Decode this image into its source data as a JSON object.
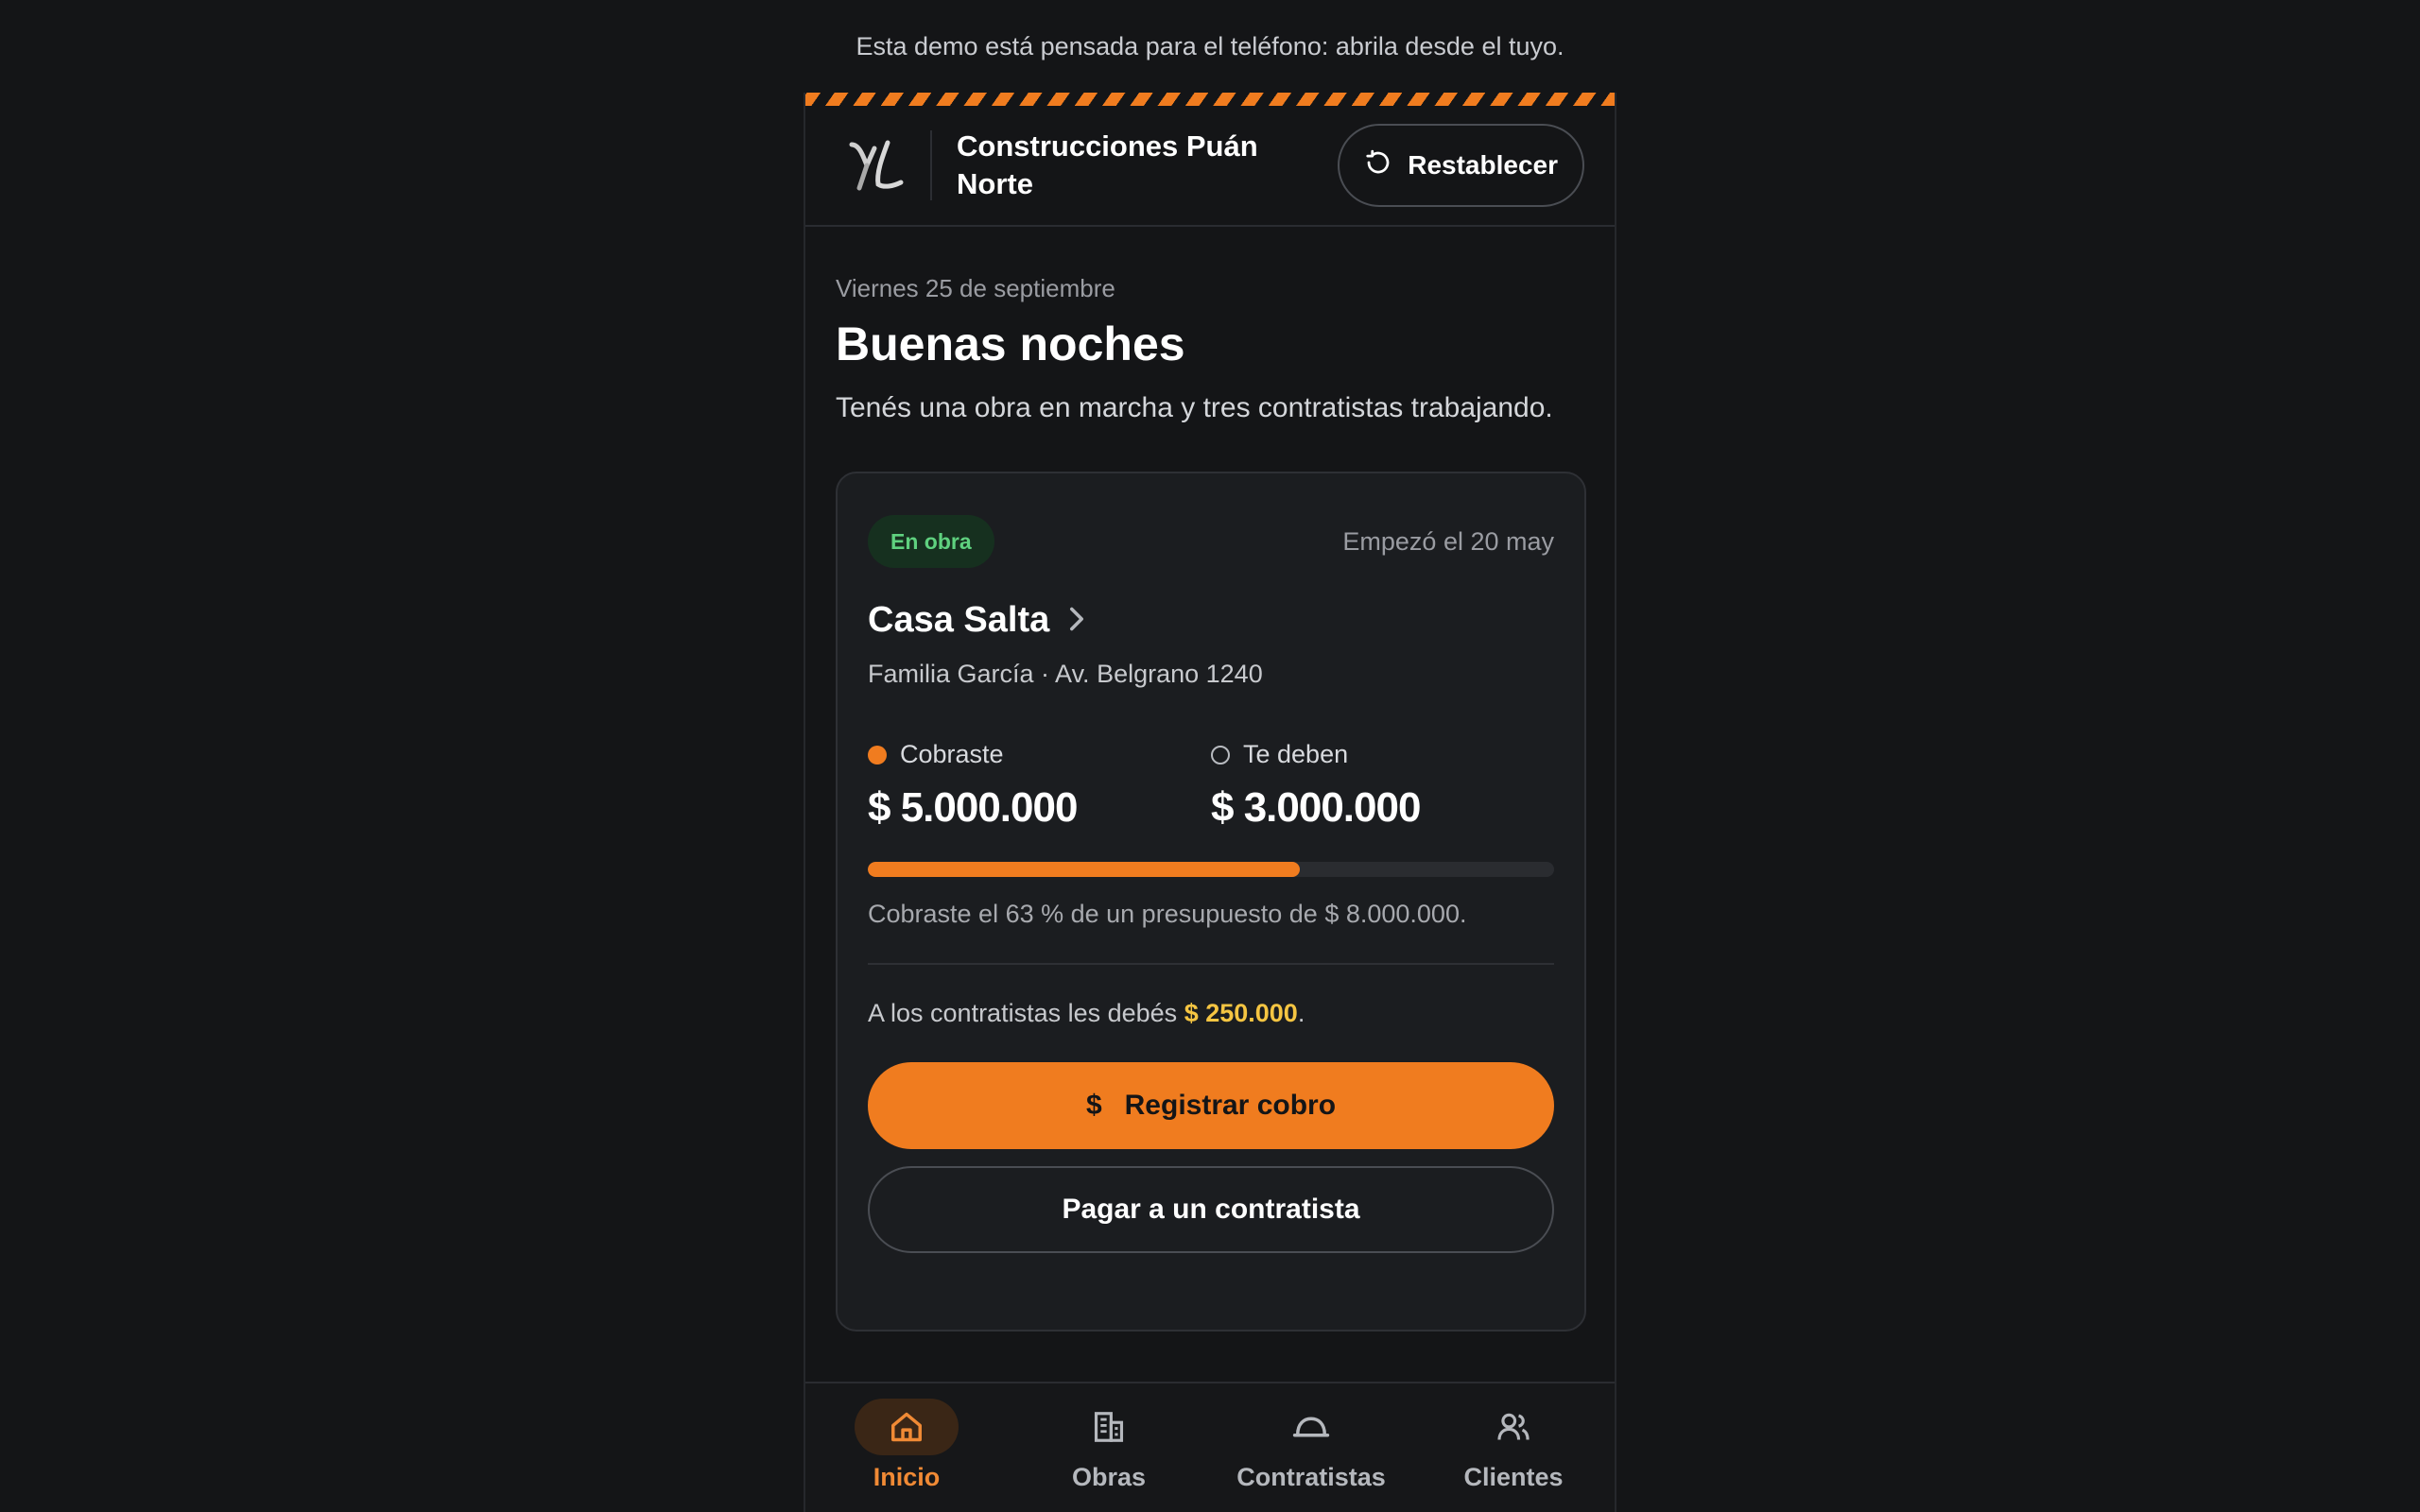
{
  "banner": "Esta demo está pensada para el teléfono: abrila desde el tuyo.",
  "header": {
    "company": "Construcciones Puán Norte",
    "reset_label": "Restablecer"
  },
  "home": {
    "date": "Viernes 25 de septiembre",
    "greeting": "Buenas noches",
    "summary": "Tenés una obra en marcha y tres contratistas trabajando."
  },
  "project": {
    "status": "En obra",
    "started": "Empezó el 20 may",
    "name": "Casa Salta",
    "meta": "Familia García · Av. Belgrano 1240",
    "collected_label": "Cobraste",
    "collected_value": "$ 5.000.000",
    "owed_label": "Te deben",
    "owed_value": "$ 3.000.000",
    "progress_fraction": 0.63,
    "progress_text": "Cobraste el 63 % de un presupuesto de $ 8.000.000.",
    "debt_prefix": "A los contratistas les debés ",
    "debt_amount": "$ 250.000",
    "debt_suffix": ".",
    "primary_action_icon": "$",
    "primary_action": "Registrar cobro",
    "secondary_action": "Pagar a un contratista"
  },
  "nav": {
    "items": [
      {
        "label": "Inicio",
        "icon": "home-icon"
      },
      {
        "label": "Obras",
        "icon": "building-icon"
      },
      {
        "label": "Contratistas",
        "icon": "hardhat-icon"
      },
      {
        "label": "Clientes",
        "icon": "users-icon"
      }
    ]
  },
  "colors": {
    "accent": "#f07c1f",
    "success": "#5fd17f",
    "warning": "#f5c542",
    "background": "#141517"
  }
}
